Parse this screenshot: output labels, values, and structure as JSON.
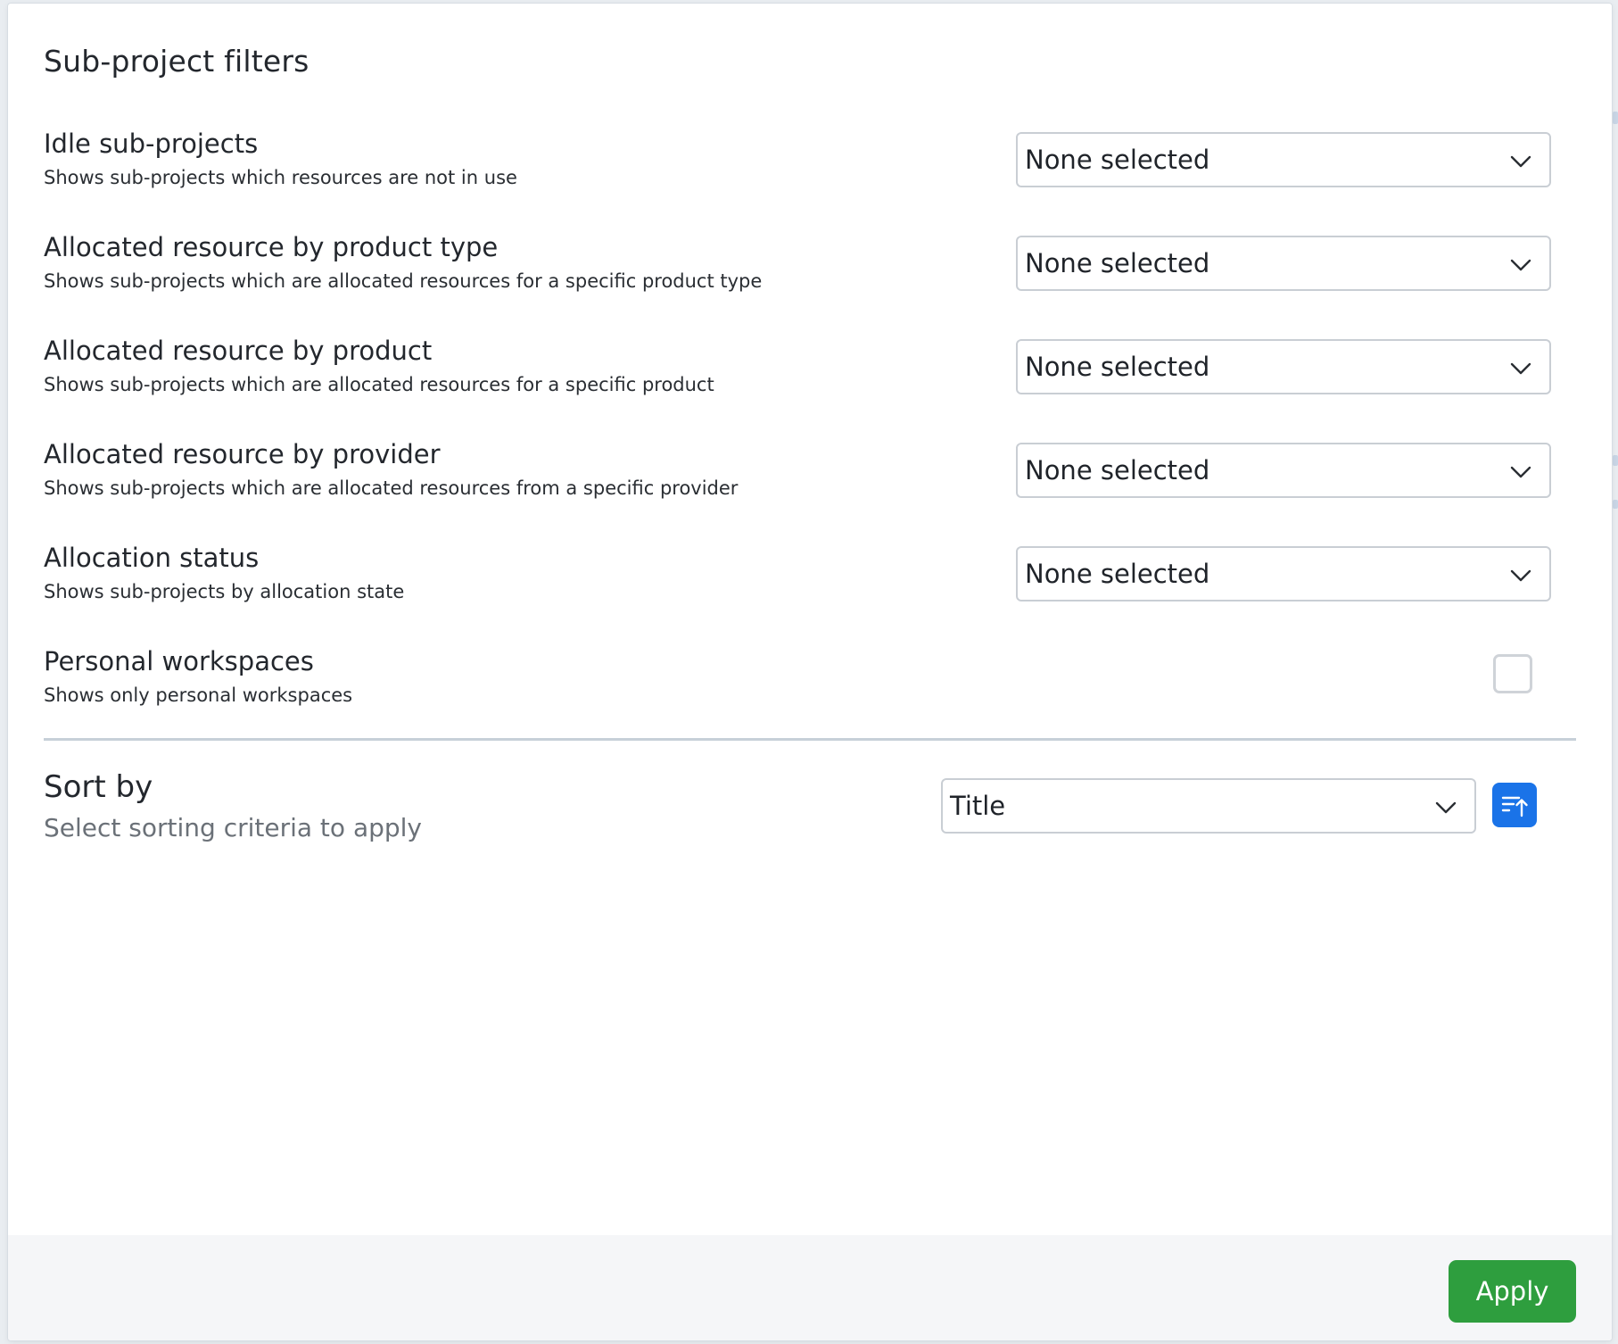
{
  "dialog": {
    "title": "Sub-project filters"
  },
  "filters": [
    {
      "label": "Idle sub-projects",
      "description": "Shows sub-projects which resources are not in use",
      "value": "None selected"
    },
    {
      "label": "Allocated resource by product type",
      "description": "Shows sub-projects which are allocated resources for a specific product type",
      "value": "None selected"
    },
    {
      "label": "Allocated resource by product",
      "description": "Shows sub-projects which are allocated resources for a specific product",
      "value": "None selected"
    },
    {
      "label": "Allocated resource by provider",
      "description": "Shows sub-projects which are allocated resources from a specific provider",
      "value": "None selected"
    },
    {
      "label": "Allocation status",
      "description": "Shows sub-projects by allocation state",
      "value": "None selected"
    }
  ],
  "personal_workspaces": {
    "label": "Personal workspaces",
    "description": "Shows only personal workspaces",
    "checked": false
  },
  "sort": {
    "label": "Sort by",
    "description": "Select sorting criteria to apply",
    "value": "Title",
    "direction_icon": "sort-ascending-icon"
  },
  "footer": {
    "apply_label": "Apply"
  },
  "colors": {
    "primary_blue": "#1a73e8",
    "apply_green": "#2e9e3e",
    "border": "#c9ced4",
    "divider": "#c7d0d8"
  }
}
